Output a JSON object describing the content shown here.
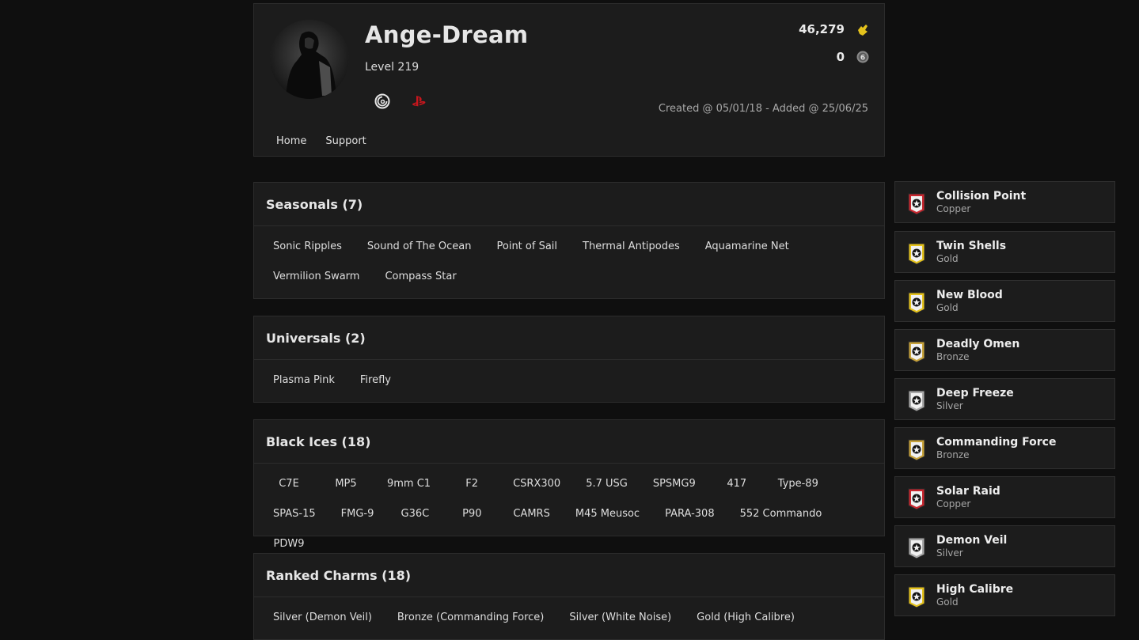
{
  "profile": {
    "username": "Ange-Dream",
    "level": "Level 219",
    "renown": "46,279",
    "credits": "0",
    "created": "Created @ 05/01/18 - Added @ 25/06/25",
    "platforms": [
      "ubisoft-icon",
      "playstation-icon"
    ],
    "nav": [
      "Home",
      "Support"
    ]
  },
  "sections": {
    "seasonals": {
      "title": "Seasonals (7)",
      "items": [
        "Sonic Ripples",
        "Sound of The Ocean",
        "Point of Sail",
        "Thermal Antipodes",
        "Aquamarine Net",
        "Vermilion Swarm",
        "Compass Star"
      ]
    },
    "universals": {
      "title": "Universals (2)",
      "items": [
        "Plasma Pink",
        "Firefly"
      ]
    },
    "black_ices": {
      "title": "Black Ices (18)",
      "items": [
        "C7E",
        "MP5",
        "9mm C1",
        "F2",
        "CSRX300",
        "5.7 USG",
        "SPSMG9",
        "417",
        "Type-89",
        "SPAS-15",
        "FMG-9",
        "G36C",
        "P90",
        "CAMRS",
        "M45 Meusoc",
        "PARA-308",
        "552 Commando",
        "PDW9"
      ]
    },
    "ranked_charms": {
      "title": "Ranked Charms (18)",
      "items": [
        "Silver (Demon Veil)",
        "Bronze (Commanding Force)",
        "Silver (White Noise)",
        "Gold (High Calibre)"
      ]
    }
  },
  "ranks": [
    {
      "name": "Collision Point",
      "tier": "Copper"
    },
    {
      "name": "Twin Shells",
      "tier": "Gold"
    },
    {
      "name": "New Blood",
      "tier": "Gold"
    },
    {
      "name": "Deadly Omen",
      "tier": "Bronze"
    },
    {
      "name": "Deep Freeze",
      "tier": "Silver"
    },
    {
      "name": "Commanding Force",
      "tier": "Bronze"
    },
    {
      "name": "Solar Raid",
      "tier": "Copper"
    },
    {
      "name": "Demon Veil",
      "tier": "Silver"
    },
    {
      "name": "High Calibre",
      "tier": "Gold"
    }
  ],
  "colors": {
    "Copper": "#c8262e",
    "Bronze": "#c7a23a",
    "Silver": "#a9a9a9",
    "Gold": "#e4c21c",
    "renown": "#e4c21c",
    "psn": "#c8161d"
  }
}
